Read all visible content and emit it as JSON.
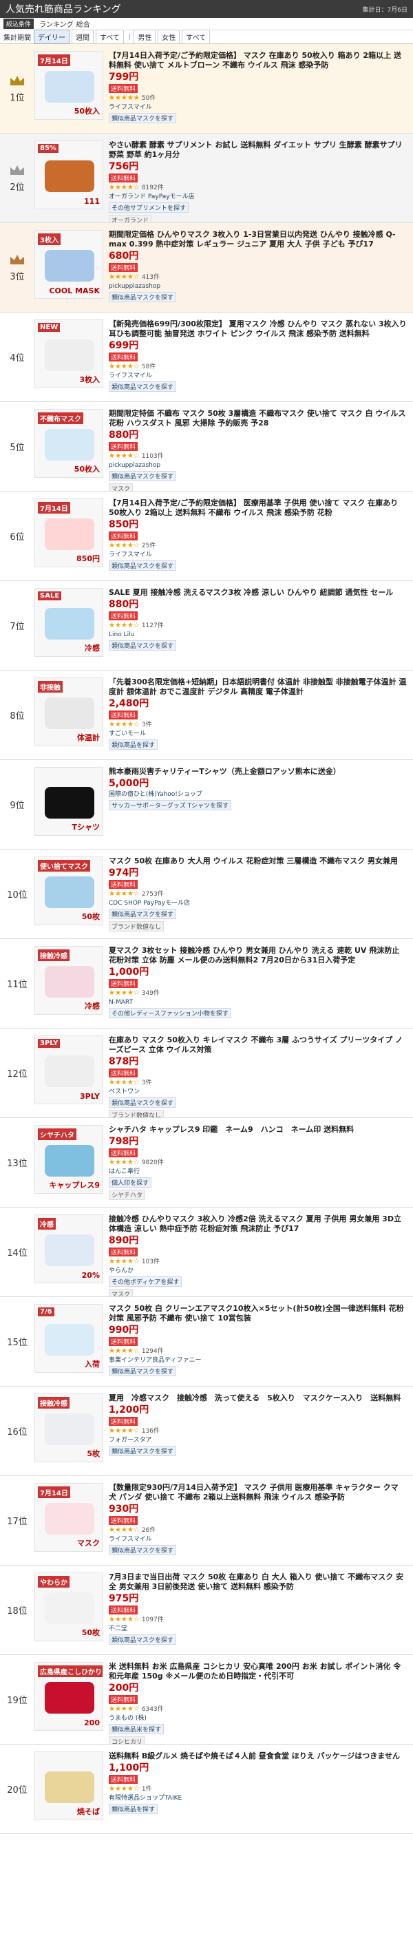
{
  "header": {
    "title": "人気売れ筋商品ランキング",
    "updated": "集計日：7月6日"
  },
  "conditions": {
    "label": "絞込条件",
    "items": [
      "ランキング",
      "総合"
    ]
  },
  "tabs": {
    "period_label": "集計期間",
    "items": [
      "デイリー",
      "週間",
      "すべて"
    ],
    "sex_label": "男性",
    "sex_items": [
      "女性",
      "すべて"
    ]
  },
  "texts": {
    "point_rate": "送料無料",
    "similar_btn": "類似商品マスクを探す"
  },
  "items": [
    {
      "rank": "1位",
      "title": "【7月14日入荷予定/ご予約限定価格】 マスク 在庫あり 50枚入り 箱あり 2箱以上 送料無料 使い捨て メルトブローン 不織布 ウイルス 飛沫 感染予防",
      "price": "799円",
      "badge": "送料無料",
      "stars": "★★★★★",
      "count": "50件",
      "shop": "ライフスマイル",
      "btn": "類似商品マスクを探す",
      "img": "50枚入",
      "ban": "7月14日",
      "color": "#cfe3f5"
    },
    {
      "rank": "2位",
      "title": "やさい酵素 酵素 サプリメント お試し 送料無料 ダイエット サプリ 生酵素 酵素サプリ 野菜 野草 約1ヶ月分",
      "price": "756円",
      "badge": "送料無料",
      "stars": "★★★★☆",
      "count": "8192件",
      "shop": "オーガランド PayPayモール店",
      "btn": "その他サプリメントを探す",
      "cat": "オーガランド",
      "img": "111",
      "ban": "85%",
      "color": "#c96b2d"
    },
    {
      "rank": "3位",
      "title": "期間限定価格 ひんやりマスク 3枚入り 1-3日営業日以内発送 ひんやり 接触冷感 Q-max 0.399 熱中症対策 レギュラー ジュニア 夏用 大人 子供 子ども 予ぴ17",
      "price": "680円",
      "badge": "送料無料",
      "stars": "★★★★☆",
      "count": "413件",
      "shop": "pickupplazashop",
      "btn": "類似商品マスクを探す",
      "img": "COOL MASK",
      "ban": "3枚入",
      "color": "#a9c7e8"
    },
    {
      "rank": "4位",
      "title": "【新発売価格699円/300枚限定】 夏用マスク 冷感 ひんやり マスク 蒸れない 3枚入り 耳ひも調整可能 抽冒発送 ホワイト ピンク ウイルス 飛沫 感染予防 送料無料",
      "price": "699円",
      "badge": "送料無料",
      "stars": "★★★★☆",
      "count": "58件",
      "shop": "ライフスマイル",
      "btn": "類似商品マスクを探す",
      "img": "3枚入",
      "ban": "NEW",
      "color": "#eeeeee"
    },
    {
      "rank": "5位",
      "title": "期間限定特価 不織布 マスク 50枚 3層構造 不織布マスク 使い捨て マスク 白 ウイルス 花粉 ハウスダスト 風邪 大掃除 予約販売 予28",
      "price": "880円",
      "badge": "送料無料",
      "stars": "★★★★☆",
      "count": "1103件",
      "shop": "pickupplazashop",
      "btn": "類似商品マスクを探す",
      "cat": "マスク",
      "img": "50枚入",
      "ban": "不織布マスク",
      "color": "#d6e9f6"
    },
    {
      "rank": "6位",
      "title": "【7月14日入荷予定/ご予約限定価格】 医療用基準 子供用 使い捨て マスク 在庫あり 50枚入り 2箱以上 送料無料 不織布 ウイルス 飛沫 感染予防 花粉",
      "price": "850円",
      "badge": "送料無料",
      "stars": "★★★★☆",
      "count": "25件",
      "shop": "ライフスマイル",
      "btn": "類似商品マスクを探す",
      "img": "850円",
      "ban": "7月14日",
      "color": "#ffd6d6"
    },
    {
      "rank": "7位",
      "title": "SALE 夏用 接触冷感 洗えるマスク3枚 冷感 涼しい ひんやり 紐調節 通気性 セール",
      "price": "880円",
      "badge": "送料無料",
      "stars": "★★★★☆",
      "count": "1127件",
      "shop": "Lino Lilu",
      "btn": "類似商品マスクを探す",
      "img": "冷感",
      "ban": "SALE",
      "color": "#b7dcf2"
    },
    {
      "rank": "8位",
      "title": "「先着300名限定価格+短納期」日本語説明書付 体温計 非接触型 非接触電子体温計 温度計 額体温計 おでこ温度計 デジタル 高精度 電子体温計",
      "price": "2,480円",
      "badge": "送料無料",
      "stars": "★★★★☆",
      "count": "3件",
      "shop": "すごいモール",
      "btn": "類似商品を探す",
      "img": "体温計",
      "ban": "非接触",
      "color": "#e8e8e8"
    },
    {
      "rank": "9位",
      "title": "熊本豪雨災害チャリティーTシャツ（売上金額ロアッソ熊本に送金）",
      "price": "5,000円",
      "badge": "",
      "stars": "",
      "count": "",
      "shop": "国際の億ひと(株)Yahoo!ショップ",
      "btn": "サッカーサポーターグッズ Tシャツを探す",
      "img": "Tシャツ",
      "ban": "",
      "color": "#111111"
    },
    {
      "rank": "10位",
      "title": "マスク 50枚 在庫あり 大人用 ウイルス 花粉症対策 三層構造 不織布マスク 男女兼用",
      "price": "974円",
      "badge": "送料無料",
      "stars": "★★★★☆",
      "count": "2753件",
      "shop": "CDC SHOP PayPayモール店",
      "btn": "類似商品マスクを探す",
      "cat": "ブランド数値なし",
      "img": "50枚",
      "ban": "使い捨てマスク",
      "color": "#a7d0ea"
    },
    {
      "rank": "11位",
      "title": "夏マスク 3枚セット 接触冷感 ひんやり 男女兼用 ひんやり 洗える 速乾 UV 飛沫防止 花粉対策 立体 防塵 メール便のみ送料無料2 7月20日から31日入荷予定",
      "price": "1,000円",
      "badge": "送料無料",
      "stars": "★★★★☆",
      "count": "349件",
      "shop": "N-MART",
      "btn": "その他レディースファッション小物を探す",
      "img": "冷感",
      "ban": "接触冷感",
      "color": "#f4d9e2"
    },
    {
      "rank": "12位",
      "title": "在庫あり マスク 50枚入り キレイマスク 不織布 3層 ふつうサイズ プリーツタイプ ノーズピース 立体 ウイルス対策",
      "price": "878円",
      "badge": "送料無料",
      "stars": "★★★★☆",
      "count": "3件",
      "shop": "ベストワン",
      "btn": "類似商品マスクを探す",
      "cat": "ブランド数値なし",
      "img": "3PLY",
      "ban": "3PLY",
      "color": "#eeeeee"
    },
    {
      "rank": "13位",
      "title": "シャチハタ キャップレス9 印鑑　ネーム9　ハンコ　ネーム印 送料無料",
      "price": "798円",
      "badge": "送料無料",
      "stars": "★★★★☆",
      "count": "9820件",
      "shop": "はんこ奉行",
      "btn": "個人印を探す",
      "cat": "シヤチハタ",
      "img": "キャップレス9",
      "ban": "シヤチハタ",
      "color": "#7fbfe0"
    },
    {
      "rank": "14位",
      "title": "接触冷感 ひんやりマスク 3枚入り 冷感2倍 洗えるマスク 夏用 子供用 男女兼用 3D立体構造 涼しい 熱中症予防 花粉症対策 飛沫防止 予ぴ17",
      "price": "890円",
      "badge": "送料無料",
      "stars": "★★★★☆",
      "count": "103件",
      "shop": "やらんか",
      "btn": "その他ボディケアを探す",
      "cat": "マスク",
      "img": "20%",
      "ban": "冷感",
      "color": "#dfeaf6"
    },
    {
      "rank": "15位",
      "title": "マスク 50枚 白 クリーンエアマスク10枚入×5セット(計50枚)全国一律送料無料 花粉対策 風邪予防 不織布 使い捨て 10営包装",
      "price": "990円",
      "badge": "送料無料",
      "stars": "★★★★☆",
      "count": "1294件",
      "shop": "事業インテリア良品ティファニー",
      "btn": "類似商品マスクを探す",
      "img": "入荷",
      "ban": "7/6",
      "color": "#d9ecf7"
    },
    {
      "rank": "16位",
      "title": "夏用　冷感マスク　接触冷感　洗って使える　5枚入り　マスクケース入り　送料無料",
      "price": "1,200円",
      "badge": "送料無料",
      "stars": "★★★★☆",
      "count": "136件",
      "shop": "フォガースタア",
      "btn": "類似商品マスクを探す",
      "img": "5枚",
      "ban": "接触冷感",
      "color": "#eceef2"
    },
    {
      "rank": "17位",
      "title": "【数量限定930円/7月14日入荷予定】 マスク 子供用 医療用基準 キャラクター クマ 犬 パンダ 使い捨て 不織布 2箱以上送料無料 飛沫 ウイルス 感染予防",
      "price": "930円",
      "badge": "送料無料",
      "stars": "★★★★☆",
      "count": "26件",
      "shop": "ライフスマイル",
      "btn": "類似商品マスクを探す",
      "img": "マスク",
      "ban": "7月14日",
      "color": "#fbe1e6"
    },
    {
      "rank": "18位",
      "title": "7月3日まで当日出荷 マスク 50枚 在庫あり 白 大人 箱入り 使い捨て 不織布マスク 安全 男女兼用 3日前後発送 使い捨て 送料無料 感染予防",
      "price": "975円",
      "badge": "送料無料",
      "stars": "★★★★☆",
      "count": "1097件",
      "shop": "不二堂",
      "btn": "類似商品マスクを探す",
      "img": "50枚",
      "ban": "やわらか",
      "color": "#f2f2f2"
    },
    {
      "rank": "19位",
      "title": "米 送料無料 お米 広島県産 コシヒカリ 安心真唯 200円 お米 お試し ポイント消化 令和元年産 150g ※メール便のため日時指定・代引不可",
      "price": "200円",
      "badge": "送料無料",
      "stars": "★★★★☆",
      "count": "6343件",
      "shop": "うまもの (株)",
      "btn": "類似商品米を探す",
      "cat": "コシヒカリ",
      "img": "200",
      "ban": "広島県産こしひかり",
      "color": "#c8102e"
    },
    {
      "rank": "20位",
      "title": "送料無料 B級グルメ 焼そばや焼そば４人前 昼食食堂 ほりえ パッケージはつきません",
      "price": "1,100円",
      "badge": "送料無料",
      "stars": "★★★★☆",
      "count": "1件",
      "shop": "有限特選品ショップTAIKE",
      "btn": "類似商品を探す",
      "img": "焼そば",
      "ban": "",
      "color": "#e9d49a"
    }
  ],
  "colors": {
    "header_bg": "#3b3b3b",
    "price": "#cc0000",
    "gold": "#b58a1b",
    "silver": "#9a9a9a",
    "bronze": "#b9773c"
  }
}
